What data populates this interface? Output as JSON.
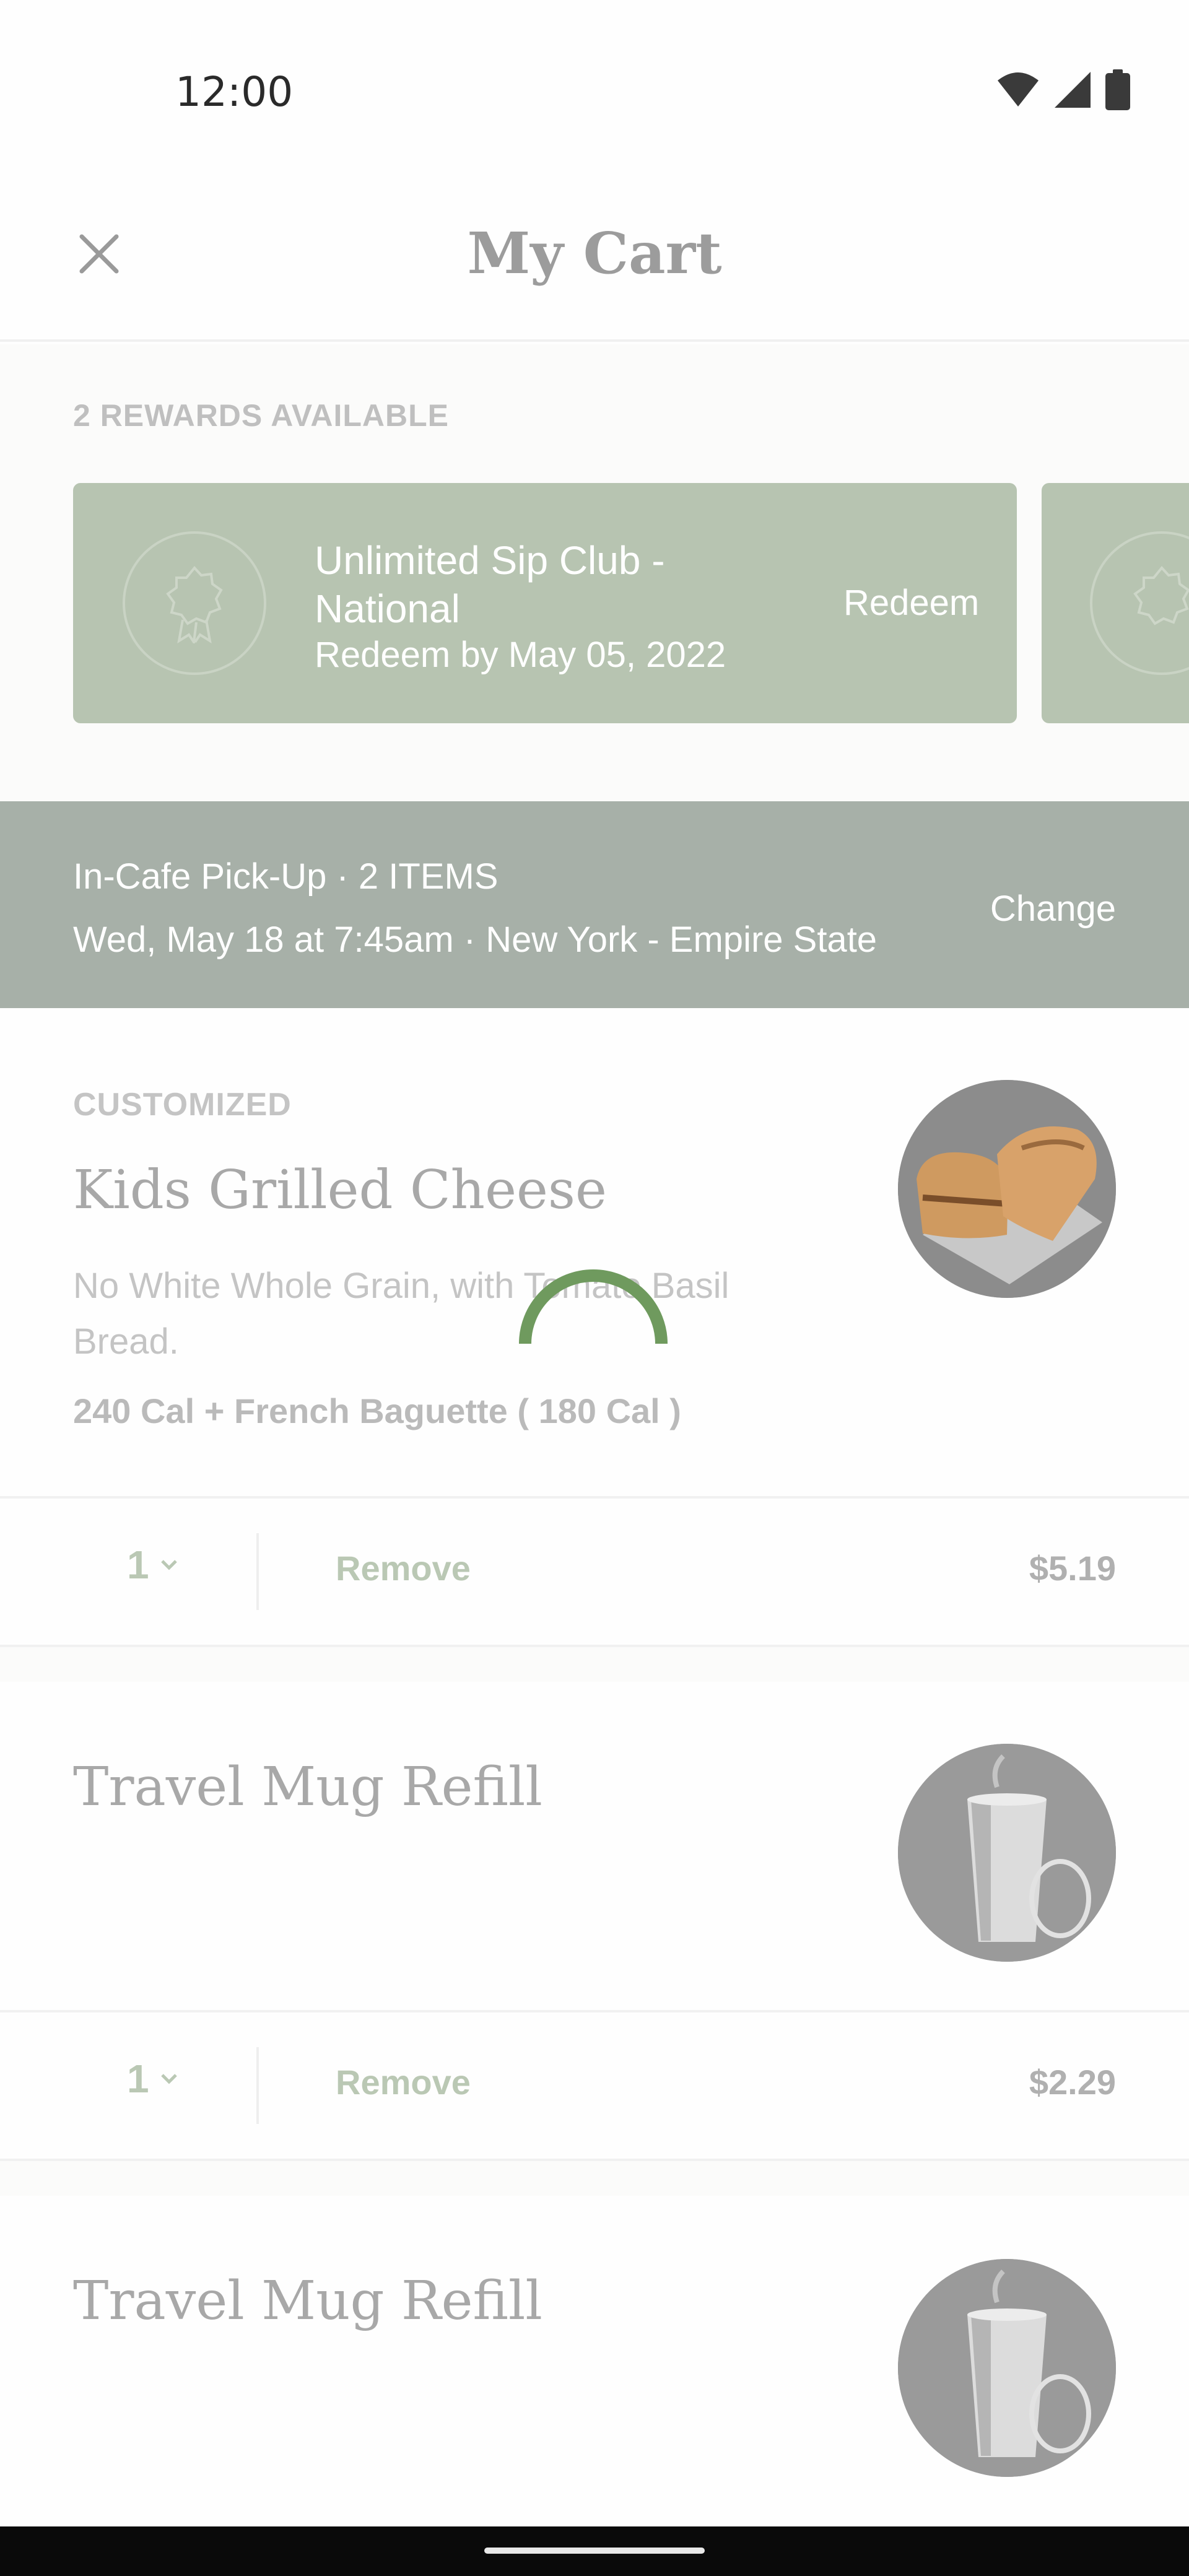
{
  "status_bar": {
    "time": "12:00",
    "icons": [
      "wifi-icon",
      "signal-icon",
      "battery-icon"
    ]
  },
  "header": {
    "title": "My Cart",
    "close_icon": "close-icon"
  },
  "rewards": {
    "heading": "2 REWARDS AVAILABLE",
    "cards": [
      {
        "title": "Unlimited Sip Club - National",
        "subtitle": "Redeem by May 05, 2022",
        "action": "Redeem",
        "icon": "award-ribbon-icon"
      }
    ]
  },
  "pickup": {
    "line1": "In-Cafe Pick-Up · 2 ITEMS",
    "line2": "Wed, May 18 at 7:45am · New York - Empire State",
    "action": "Change"
  },
  "items": [
    {
      "tag": "CUSTOMIZED",
      "name": "Kids Grilled Cheese",
      "description": "No White Whole Grain, with Tomato Basil Bread.",
      "calories": "240 Cal + French Baguette ( 180 Cal )",
      "quantity": "1",
      "remove_label": "Remove",
      "price": "$5.19",
      "image": "grilled-cheese-sandwich"
    },
    {
      "name": "Travel Mug Refill",
      "quantity": "1",
      "remove_label": "Remove",
      "price": "$2.29",
      "image": "travel-mug"
    },
    {
      "name": "Travel Mug Refill",
      "image": "travel-mug"
    }
  ],
  "colors": {
    "reward_card": "#b7c4b1",
    "pickup_banner": "#a7b0a8",
    "action_text": "#bac8b4",
    "spinner": "#6f9a5e"
  }
}
